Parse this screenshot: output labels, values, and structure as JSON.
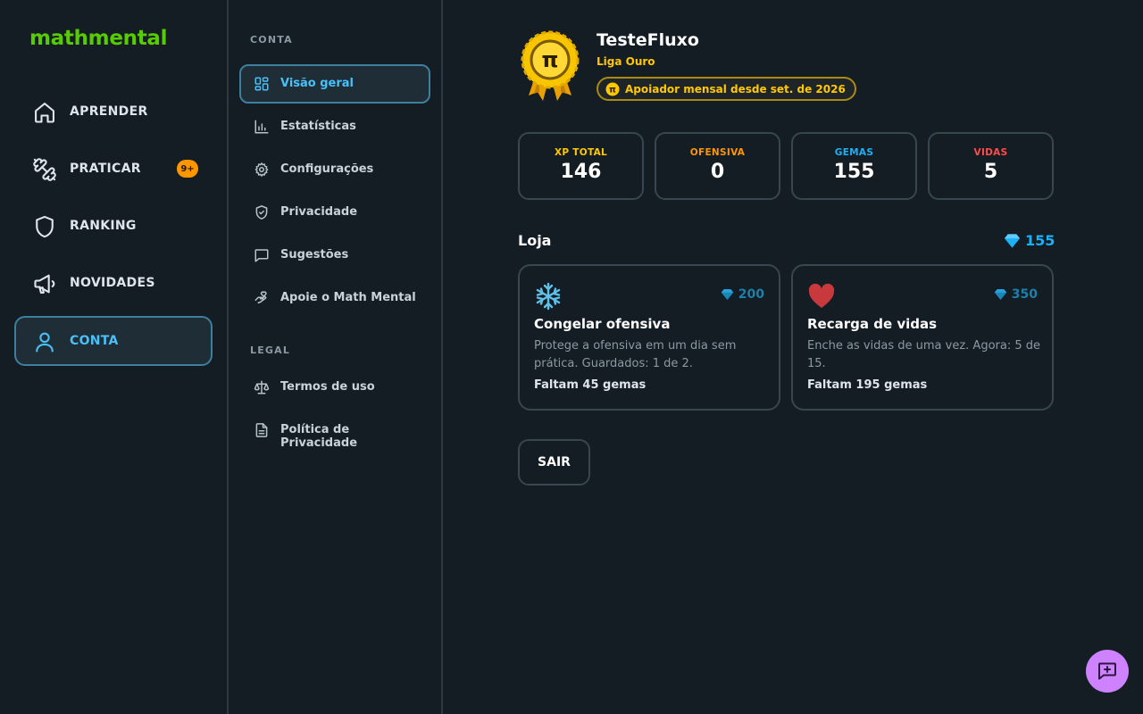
{
  "app": {
    "logo": "mathmental"
  },
  "nav": {
    "items": [
      {
        "label": "APRENDER",
        "icon": "home-icon"
      },
      {
        "label": "PRATICAR",
        "icon": "dumbbell-icon",
        "badge": "9+"
      },
      {
        "label": "RANKING",
        "icon": "shield-icon"
      },
      {
        "label": "NOVIDADES",
        "icon": "megaphone-icon"
      },
      {
        "label": "CONTA",
        "icon": "user-icon",
        "active": true
      }
    ]
  },
  "subnav": {
    "account_title": "CONTA",
    "account_items": [
      {
        "label": "Visão geral",
        "icon": "grid-icon",
        "active": true
      },
      {
        "label": "Estatísticas",
        "icon": "bar-chart-icon"
      },
      {
        "label": "Configurações",
        "icon": "gear-icon"
      },
      {
        "label": "Privacidade",
        "icon": "shield-check-icon"
      },
      {
        "label": "Sugestões",
        "icon": "message-icon"
      },
      {
        "label": "Apoie o Math Mental",
        "icon": "hand-heart-icon"
      }
    ],
    "legal_title": "LEGAL",
    "legal_items": [
      {
        "label": "Termos de uso",
        "icon": "scale-icon"
      },
      {
        "label": "Política de Privacidade",
        "icon": "document-icon"
      }
    ]
  },
  "profile": {
    "name": "TesteFluxo",
    "league": "Liga Ouro",
    "supporter": "Apoiador mensal desde set. de 2026",
    "medal_symbol": "π"
  },
  "stats": [
    {
      "label": "XP TOTAL",
      "value": "146",
      "color": "#ffc800"
    },
    {
      "label": "OFENSIVA",
      "value": "0",
      "color": "#ff9600"
    },
    {
      "label": "GEMAS",
      "value": "155",
      "color": "#1cb0f6"
    },
    {
      "label": "VIDAS",
      "value": "5",
      "color": "#ff4b4b"
    }
  ],
  "shop": {
    "title": "Loja",
    "gems": "155",
    "items": [
      {
        "title": "Congelar ofensiva",
        "price": "200",
        "icon": "snowflake-icon",
        "description": "Protege a ofensiva em um dia sem prática. Guardados: 1 de 2.",
        "footer": "Faltam 45 gemas"
      },
      {
        "title": "Recarga de vidas",
        "price": "350",
        "icon": "heart-icon",
        "description": "Enche as vidas de uma vez. Agora: 5 de 15.",
        "footer": "Faltam 195 gemas"
      }
    ]
  },
  "logout_label": "SAIR",
  "colors": {
    "brand": "#58cc02",
    "accent": "#49c0f8",
    "gold": "#ffc800",
    "fab": "#ce82ff"
  }
}
